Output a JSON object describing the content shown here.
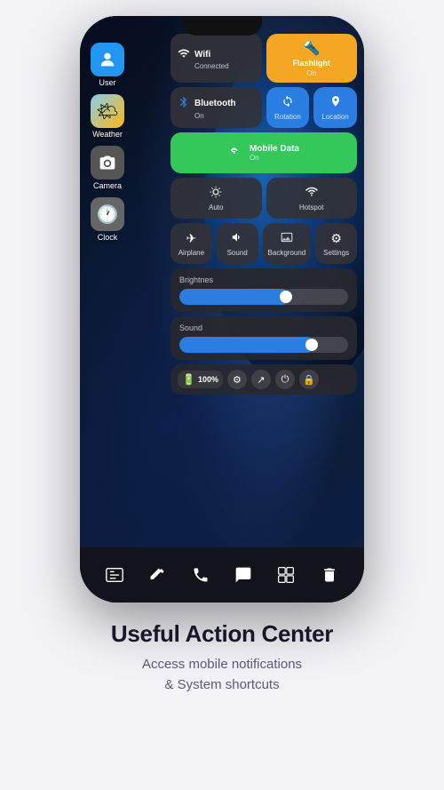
{
  "app": {
    "title": "Useful Action Center",
    "subtitle": "Access mobile notifications\n& System shortcuts"
  },
  "phone": {
    "dock_icons": [
      "⊞",
      "✦",
      "📞",
      "⬛",
      "⇅",
      "🗑"
    ]
  },
  "app_icons": [
    {
      "id": "user",
      "icon": "👤",
      "label": "User",
      "bg": "#2196F3"
    },
    {
      "id": "weather",
      "icon": "🌤",
      "label": "Weather",
      "bg": "#FF9800"
    },
    {
      "id": "camera",
      "icon": "📷",
      "label": "Camera",
      "bg": "#555"
    },
    {
      "id": "clock",
      "icon": "🕐",
      "label": "Clock",
      "bg": "#888"
    }
  ],
  "controls": {
    "wifi": {
      "label": "Wifi",
      "status": "Connected",
      "icon": "wifi"
    },
    "flashlight": {
      "label": "Flashlight",
      "status": "On",
      "icon": "flashlight"
    },
    "bluetooth": {
      "label": "Bluetooth",
      "status": "On",
      "icon": "bluetooth"
    },
    "rotation": {
      "label": "Rotation",
      "icon": "rotation"
    },
    "location": {
      "label": "Location",
      "icon": "location"
    },
    "mobile_data": {
      "label": "Mobile Data",
      "status": "On",
      "icon": "mobile"
    },
    "auto": {
      "label": "Auto",
      "icon": "auto"
    },
    "hotspot": {
      "label": "Hotspot",
      "icon": "hotspot"
    },
    "airplane": {
      "label": "Airplane",
      "icon": "airplane"
    },
    "sound": {
      "label": "Sound",
      "icon": "sound"
    },
    "background": {
      "label": "Background",
      "icon": "background"
    },
    "settings": {
      "label": "Settings",
      "icon": "settings"
    }
  },
  "sliders": {
    "brightness": {
      "label": "Brightnes",
      "value": 65
    },
    "sound": {
      "label": "Sound",
      "value": 80
    }
  },
  "status": {
    "battery": "100%",
    "battery_icon": "🔋"
  },
  "colors": {
    "blue": "#2a7de1",
    "orange": "#f5a623",
    "green": "#34c759",
    "dark_btn": "rgba(50,50,55,0.9)"
  }
}
